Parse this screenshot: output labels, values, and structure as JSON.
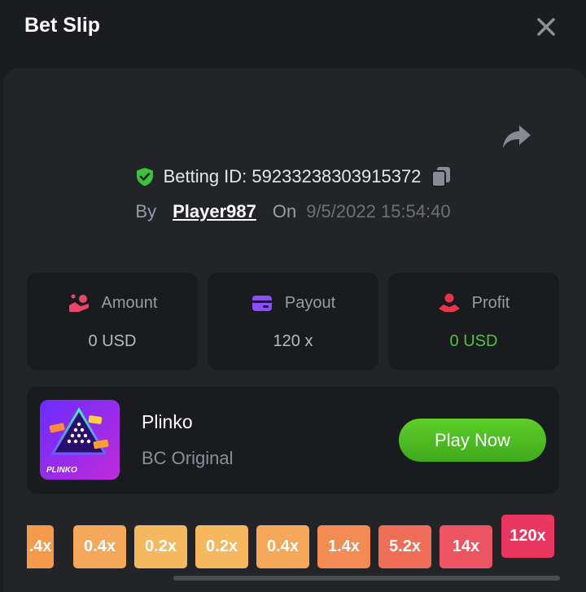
{
  "header": {
    "title": "Bet Slip"
  },
  "bet": {
    "id_label": "Betting ID: 59233238303915372",
    "by_label": "By",
    "player": "Player987",
    "on_label": "On",
    "date": "9/5/2022 15:54:40"
  },
  "stats": [
    {
      "label": "Amount",
      "value": "0 USD",
      "icon": "coins-hand-icon",
      "color": "#e8476a"
    },
    {
      "label": "Payout",
      "value": "120 x",
      "icon": "wallet-icon",
      "color": "#8a4dff"
    },
    {
      "label": "Profit",
      "value": "0 USD",
      "icon": "profit-hand-icon",
      "color": "#e8334a",
      "value_color": "#4cc53a"
    }
  ],
  "game": {
    "name": "Plinko",
    "provider": "BC Original",
    "thumb_label": "PLINKO",
    "play_label": "Play Now"
  },
  "multipliers": [
    {
      "label": ".4x",
      "color": "#f59a4a"
    },
    {
      "label": "0.4x",
      "color": "#f5a85a"
    },
    {
      "label": "0.2x",
      "color": "#f6b85f"
    },
    {
      "label": "0.2x",
      "color": "#f6b85f"
    },
    {
      "label": "0.4x",
      "color": "#f5a85a"
    },
    {
      "label": "1.4x",
      "color": "#f38b55"
    },
    {
      "label": "5.2x",
      "color": "#f06d58"
    },
    {
      "label": "14x",
      "color": "#ee5562"
    },
    {
      "label": "120x",
      "color": "#e9375f",
      "active": true
    }
  ],
  "colors": {
    "accent_green": "#4cc53a",
    "background": "#1b1c20",
    "panel": "#232428",
    "card": "#1a1b1e"
  }
}
